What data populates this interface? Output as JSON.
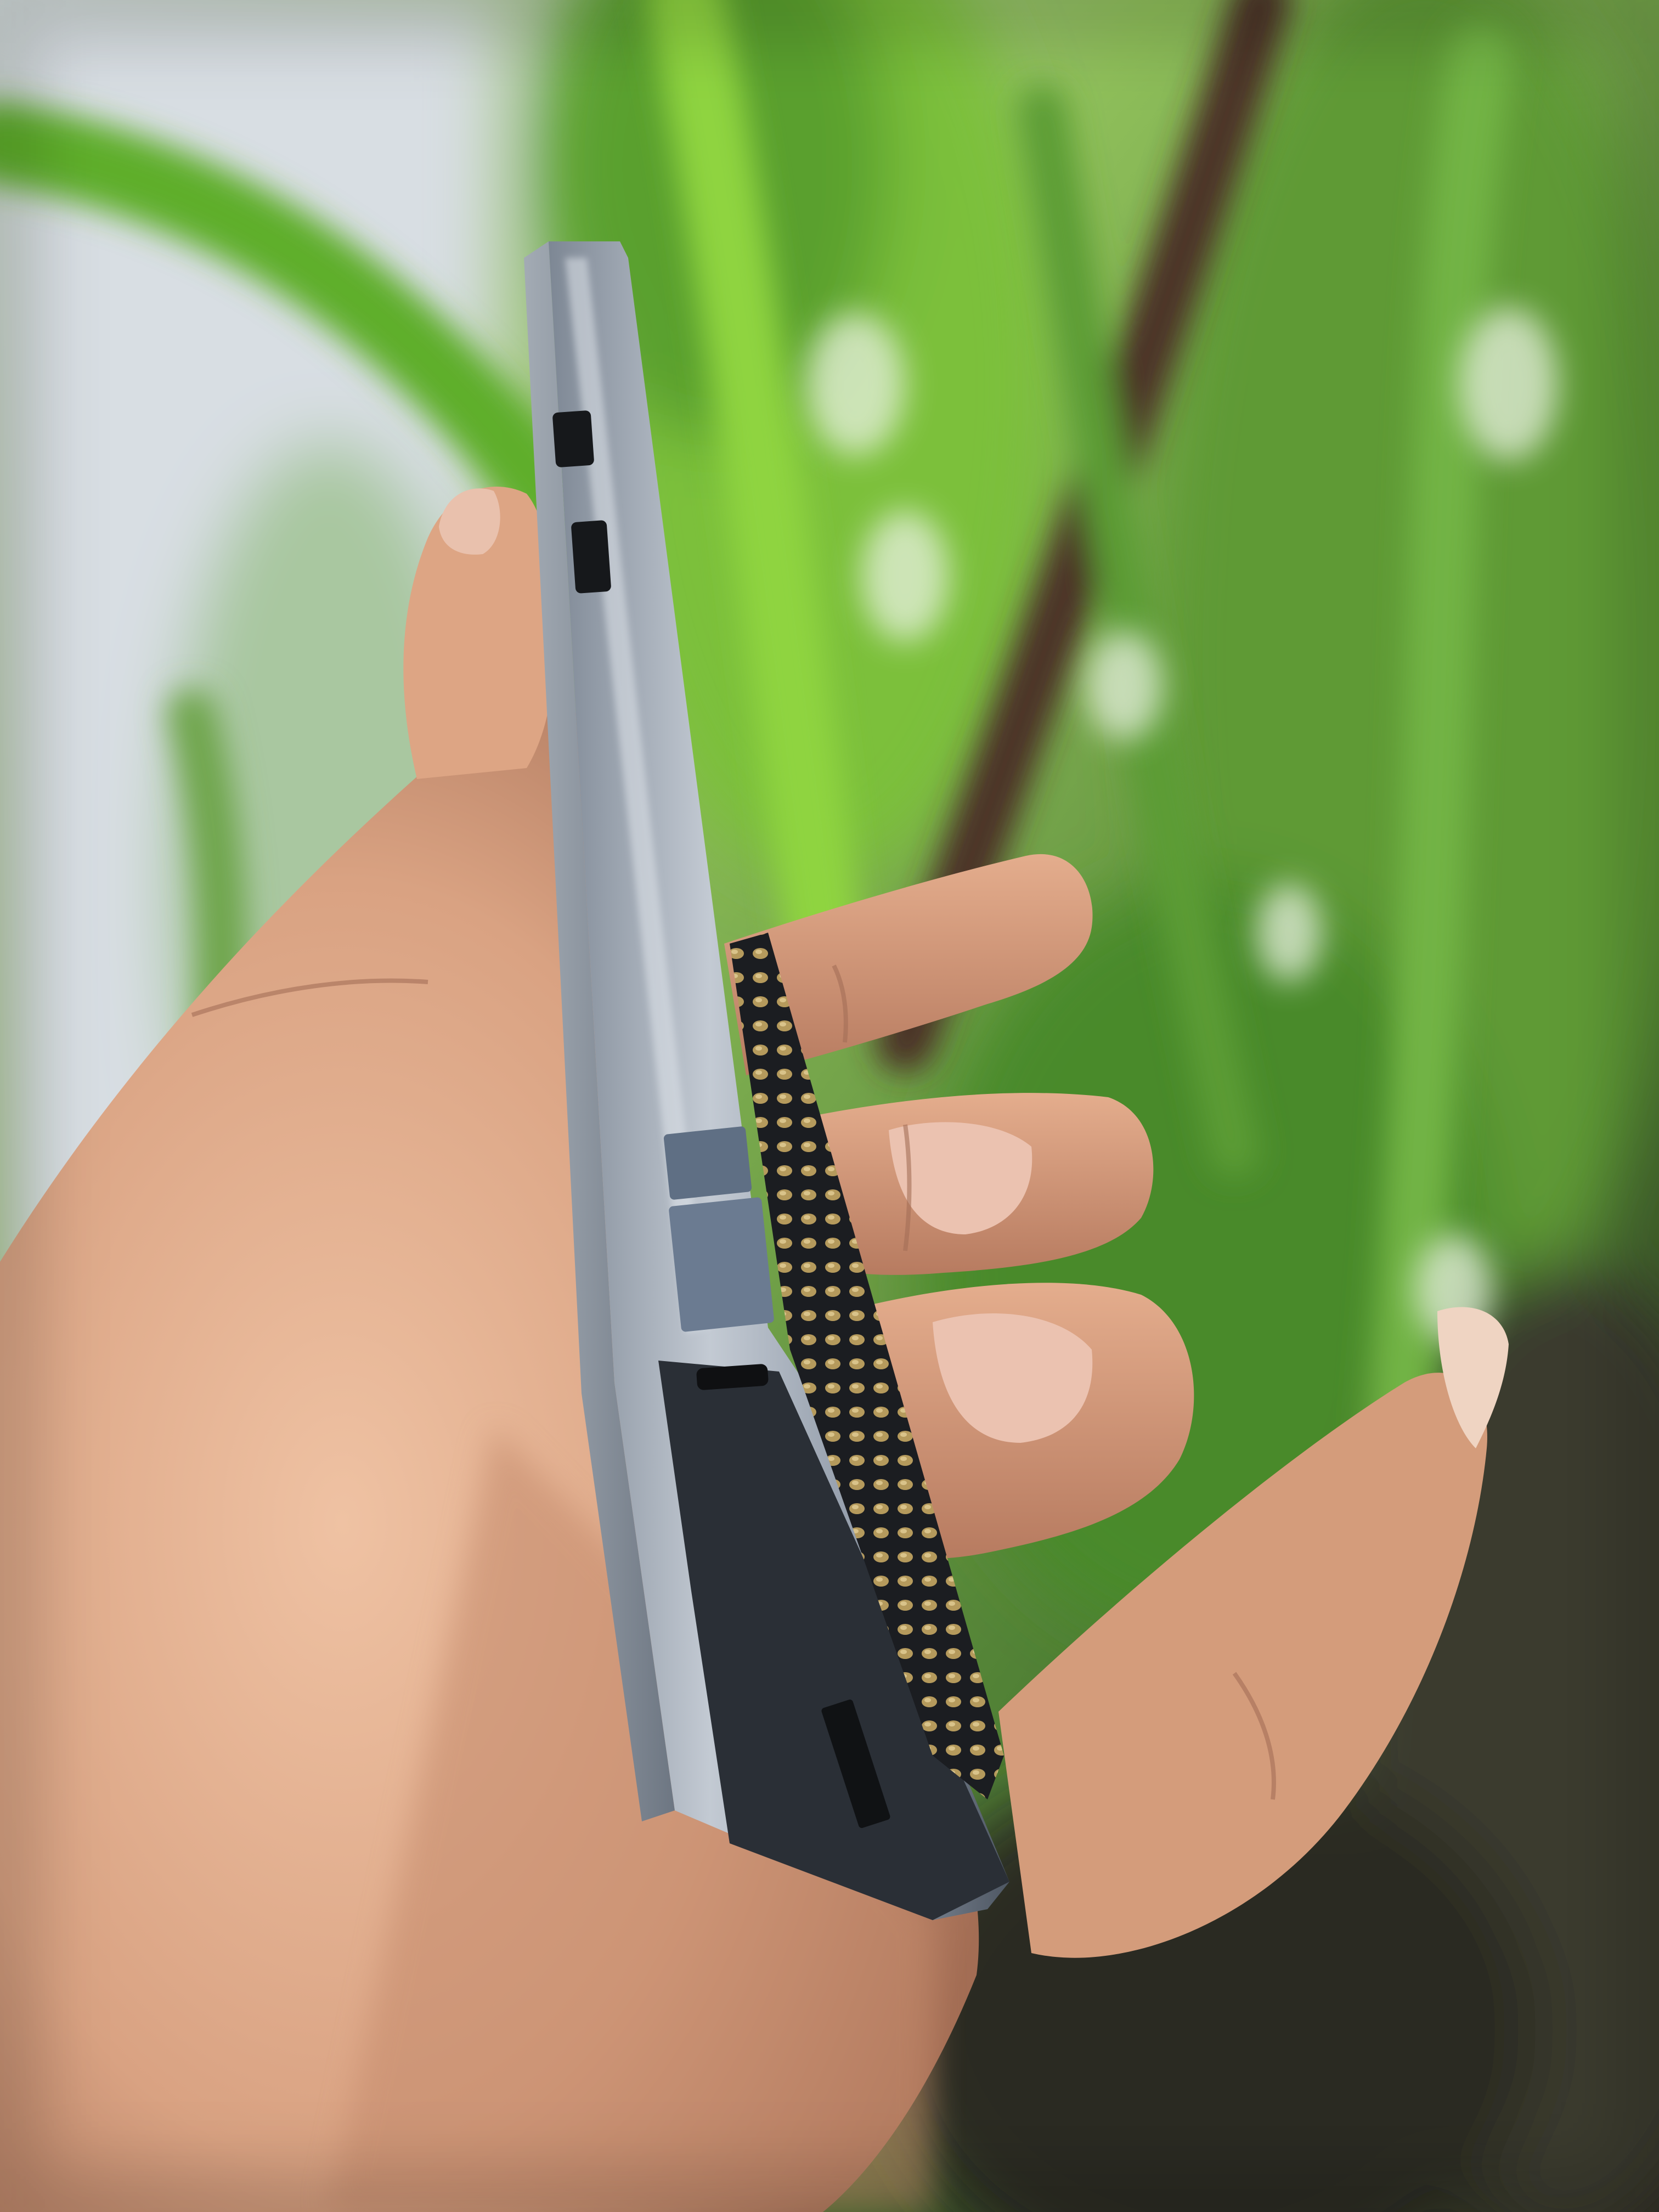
{
  "scene": {
    "colors": {
      "sky": "#dfe4ea",
      "leaf_bright": "#7fc23b",
      "leaf_mid": "#4f8f2c",
      "leaf_dark": "#2f5a1c",
      "trunk": "#4a3226",
      "ground": "#3a3328",
      "skin_light": "#e8b99a",
      "skin_mid": "#d39d7c",
      "skin_shadow": "#9e6a52",
      "nail": "#e7c0ae",
      "device_frame": "#9aa4b1",
      "device_frame_shadow": "#5c6673",
      "device_dark": "#1f2226",
      "key_gold": "#b09356"
    }
  }
}
